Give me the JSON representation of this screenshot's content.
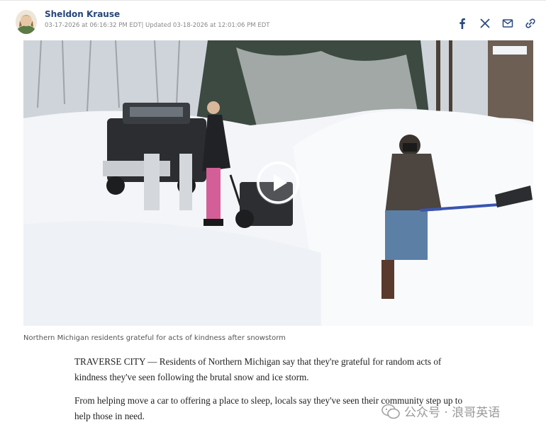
{
  "author": {
    "name": "Sheldon Krause",
    "timestamps": "03-17-2026 at 06:16:32 PM EDT| Updated 03-18-2026 at 12:01:06 PM EDT"
  },
  "share_icons": [
    "facebook-icon",
    "x-icon",
    "email-icon",
    "link-icon"
  ],
  "media": {
    "caption": "Northern Michigan residents grateful for acts of kindness after snowstorm"
  },
  "article": {
    "paragraphs": [
      "TRAVERSE CITY — Residents of Northern Michigan say that they're grateful for random acts of kindness they've seen following the brutal snow and ice storm.",
      "From helping move a car to offering a place to sleep, locals say they've seen their community step up to help those in need."
    ]
  },
  "watermark": {
    "text": "公众号 · 浪哥英语"
  },
  "colors": {
    "accent": "#27457a",
    "icon": "#2a4a7e"
  }
}
